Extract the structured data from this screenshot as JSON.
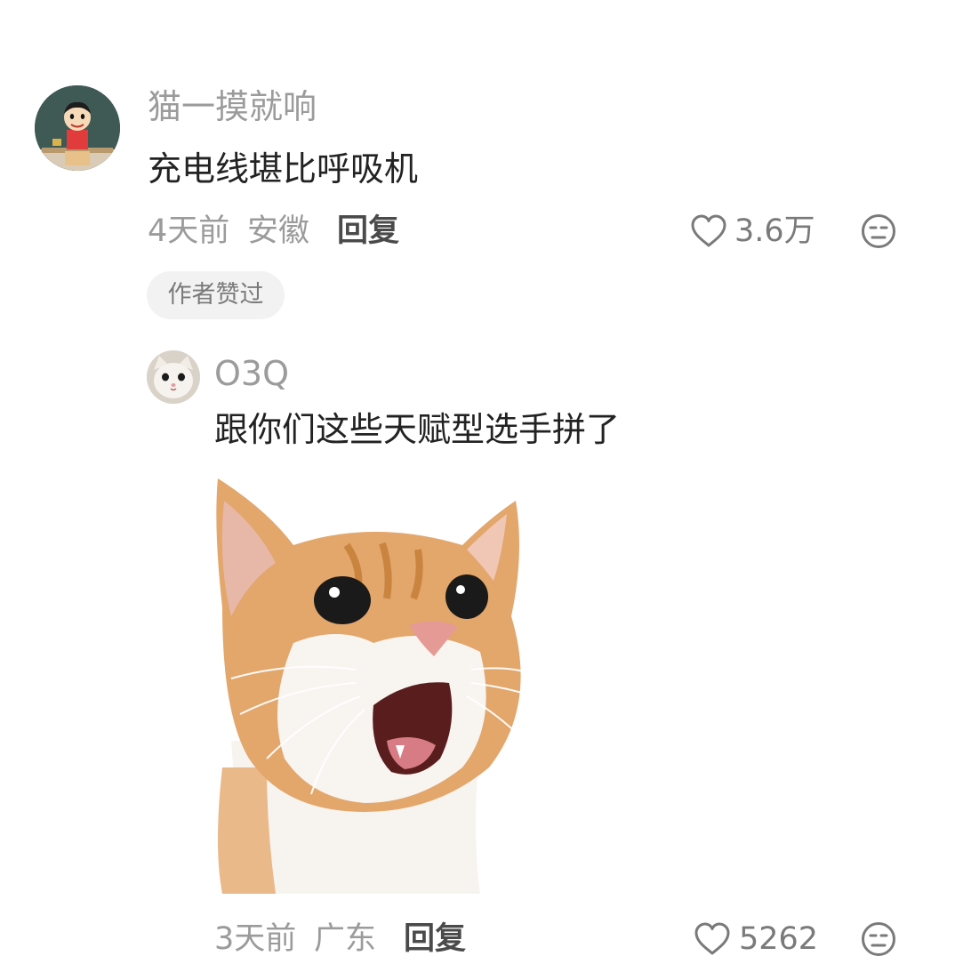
{
  "comment": {
    "username": "猫一摸就响",
    "text": "充电线堪比呼吸机",
    "time": "4天前",
    "location": "安徽",
    "reply_label": "回复",
    "likes": "3.6万",
    "badge": "作者赞过",
    "avatar": "cartoon-boy-avatar"
  },
  "reply": {
    "username": "O3Q",
    "text": "跟你们这些天赋型选手拼了",
    "time": "3天前",
    "location": "广东",
    "reply_label": "回复",
    "likes": "5262",
    "avatar": "kitten-avatar",
    "sticker": "orange-cat-meme-sticker"
  },
  "icons": {
    "like": "heart-outline-icon",
    "dislike": "neutral-face-icon"
  },
  "colors": {
    "secondary_text": "#9b9b9b",
    "primary_text": "#222222",
    "badge_bg": "#f2f2f2"
  }
}
